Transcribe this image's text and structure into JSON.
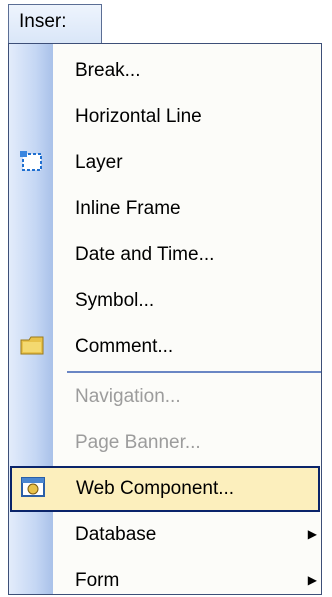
{
  "menubar": {
    "tab_label": "Inser:"
  },
  "menu": {
    "items": [
      {
        "label": "Break...",
        "enabled": true
      },
      {
        "label": "Horizontal Line",
        "enabled": true
      },
      {
        "label": "Layer",
        "enabled": true,
        "icon": "layer-icon"
      },
      {
        "label": "Inline Frame",
        "enabled": true
      },
      {
        "label": "Date and Time...",
        "enabled": true
      },
      {
        "label": "Symbol...",
        "enabled": true
      },
      {
        "label": "Comment...",
        "enabled": true,
        "icon": "comment-icon"
      },
      {
        "label": "Navigation...",
        "enabled": false
      },
      {
        "label": "Page Banner...",
        "enabled": false
      },
      {
        "label": "Web Component...",
        "enabled": true,
        "highlighted": true,
        "icon": "web-component-icon"
      },
      {
        "label": "Database",
        "enabled": true,
        "submenu": true
      },
      {
        "label": "Form",
        "enabled": true,
        "submenu": true
      }
    ]
  },
  "colors": {
    "highlight_bg": "#fcefbd",
    "highlight_border": "#0a246a",
    "gutter": "#c5d7f4",
    "disabled_text": "#9c9c9c"
  }
}
